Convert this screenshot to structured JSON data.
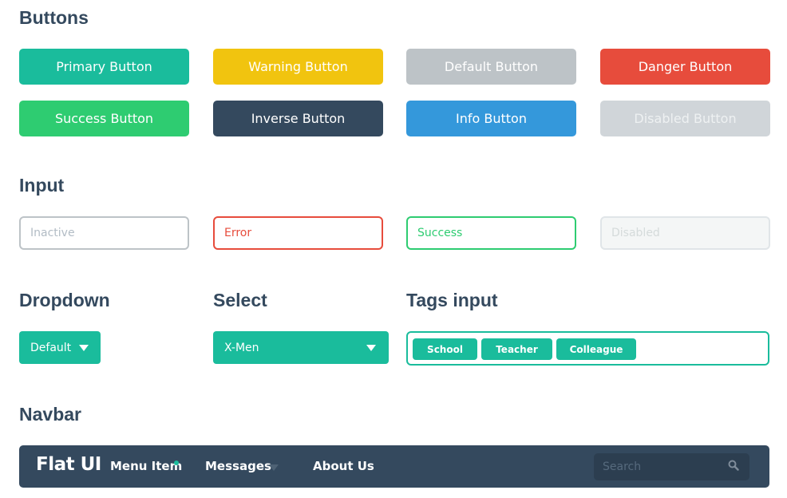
{
  "sections": {
    "buttons": "Buttons",
    "input": "Input",
    "dropdown": "Dropdown",
    "select": "Select",
    "tags": "Tags input",
    "navbar": "Navbar"
  },
  "buttons": {
    "primary": "Primary Button",
    "warning": "Warning Button",
    "default": "Default Button",
    "danger": "Danger Button",
    "success": "Success Button",
    "inverse": "Inverse Button",
    "info": "Info Button",
    "disabled": "Disabled Button"
  },
  "inputs": {
    "inactive": "Inactive",
    "error": "Error",
    "success": "Success",
    "disabled": "Disabled"
  },
  "dropdown": {
    "label": "Default"
  },
  "select": {
    "value": "X-Men"
  },
  "tags": [
    "School",
    "Teacher",
    "Colleague"
  ],
  "navbar": {
    "brand": "Flat UI",
    "items": [
      "Menu Item",
      "Messages",
      "About Us"
    ],
    "search_placeholder": "Search"
  },
  "colors": {
    "turquoise": "#1abc9c",
    "sunflower": "#f1c40f",
    "silver": "#bdc3c7",
    "alizarin": "#e74c3c",
    "emerald": "#2ecc71",
    "midnight": "#34495e",
    "peter_river": "#3498db"
  },
  "icons": {
    "dropdown_caret": "caret-down-icon",
    "nav_dot": "notification-dot-icon",
    "nav_caret": "caret-down-icon",
    "search": "search-icon"
  }
}
